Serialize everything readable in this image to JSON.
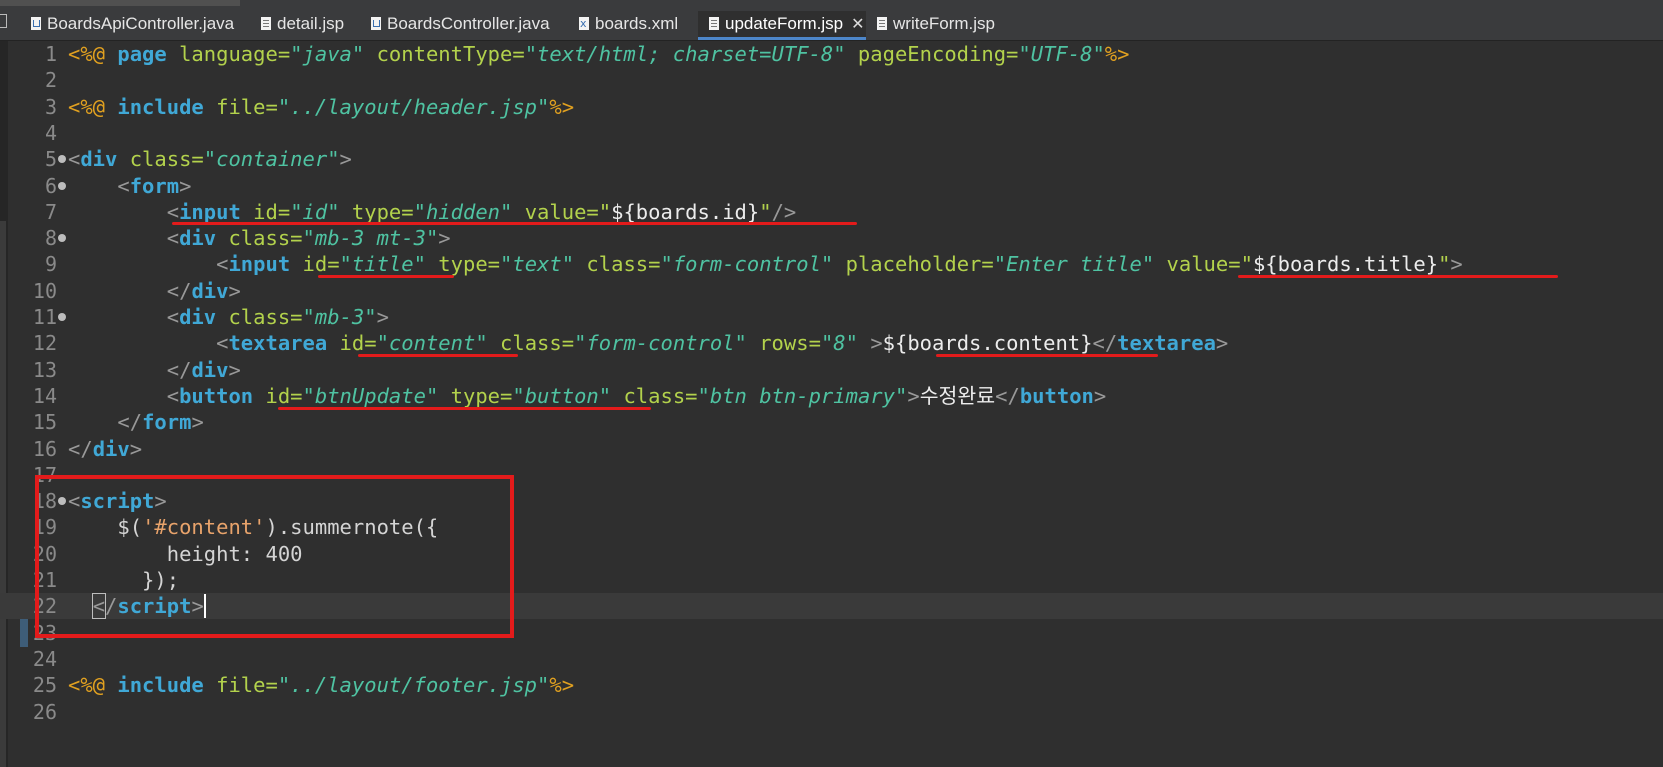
{
  "tabs": [
    {
      "label": "BoardsApiController.java",
      "icon": "java-file-icon",
      "active": false
    },
    {
      "label": "detail.jsp",
      "icon": "jsp-file-icon",
      "active": false
    },
    {
      "label": "BoardsController.java",
      "icon": "java-file-icon",
      "active": false
    },
    {
      "label": "boards.xml",
      "icon": "xml-file-icon",
      "active": false
    },
    {
      "label": "updateForm.jsp",
      "icon": "jsp-file-icon",
      "active": true,
      "close": "✕"
    },
    {
      "label": "writeForm.jsp",
      "icon": "jsp-file-icon",
      "active": false
    }
  ],
  "editor": {
    "active_file": "updateForm.jsp",
    "current_line": 22,
    "lines": [
      {
        "n": "1",
        "fold": false,
        "tokens": [
          [
            "jsp",
            "<%@ "
          ],
          [
            "kw",
            "page"
          ],
          [
            "attr",
            " language="
          ],
          [
            "str",
            "\"java\""
          ],
          [
            "attr",
            " contentType="
          ],
          [
            "str",
            "\"text/html; charset=UTF-8\""
          ],
          [
            "attr",
            " pageEncoding="
          ],
          [
            "str",
            "\"UTF-8\""
          ],
          [
            "jsp",
            "%>"
          ]
        ]
      },
      {
        "n": "2",
        "fold": false,
        "tokens": []
      },
      {
        "n": "3",
        "fold": false,
        "tokens": [
          [
            "jsp",
            "<%@ "
          ],
          [
            "kw",
            "include"
          ],
          [
            "attr",
            " file="
          ],
          [
            "str",
            "\"../layout/header.jsp\""
          ],
          [
            "jsp",
            "%>"
          ]
        ]
      },
      {
        "n": "4",
        "fold": false,
        "tokens": []
      },
      {
        "n": "5",
        "fold": true,
        "tokens": [
          [
            "br",
            "<"
          ],
          [
            "kw",
            "div"
          ],
          [
            "attr",
            " class="
          ],
          [
            "str",
            "\"container\""
          ],
          [
            "br",
            ">"
          ]
        ]
      },
      {
        "n": "6",
        "fold": true,
        "tokens": [
          [
            "txt",
            "    "
          ],
          [
            "br",
            "<"
          ],
          [
            "kw",
            "form"
          ],
          [
            "br",
            ">"
          ]
        ]
      },
      {
        "n": "7",
        "fold": false,
        "tokens": [
          [
            "txt",
            "        "
          ],
          [
            "br",
            "<"
          ],
          [
            "kw",
            "input"
          ],
          [
            "attr",
            " id="
          ],
          [
            "str",
            "\"id\""
          ],
          [
            "attr",
            " type="
          ],
          [
            "str",
            "\"hidden\""
          ],
          [
            "attr",
            " value="
          ],
          [
            "q",
            "\""
          ],
          [
            "txt",
            "${boards.id}"
          ],
          [
            "q",
            "\""
          ],
          [
            "br",
            "/>"
          ]
        ]
      },
      {
        "n": "8",
        "fold": true,
        "tokens": [
          [
            "txt",
            "        "
          ],
          [
            "br",
            "<"
          ],
          [
            "kw",
            "div"
          ],
          [
            "attr",
            " class="
          ],
          [
            "str",
            "\"mb-3 mt-3\""
          ],
          [
            "br",
            ">"
          ]
        ]
      },
      {
        "n": "9",
        "fold": false,
        "tokens": [
          [
            "txt",
            "            "
          ],
          [
            "br",
            "<"
          ],
          [
            "kw",
            "input"
          ],
          [
            "attr",
            " id="
          ],
          [
            "str",
            "\"title\""
          ],
          [
            "attr",
            " type="
          ],
          [
            "str",
            "\"text\""
          ],
          [
            "attr",
            " class="
          ],
          [
            "str",
            "\"form-control\""
          ],
          [
            "attr",
            " placeholder="
          ],
          [
            "str",
            "\"Enter title\""
          ],
          [
            "attr",
            " value="
          ],
          [
            "q",
            "\""
          ],
          [
            "txt",
            "${boards.title}"
          ],
          [
            "q",
            "\""
          ],
          [
            "br",
            ">"
          ]
        ]
      },
      {
        "n": "10",
        "fold": false,
        "tokens": [
          [
            "txt",
            "        "
          ],
          [
            "br",
            "</"
          ],
          [
            "kw",
            "div"
          ],
          [
            "br",
            ">"
          ]
        ]
      },
      {
        "n": "11",
        "fold": true,
        "tokens": [
          [
            "txt",
            "        "
          ],
          [
            "br",
            "<"
          ],
          [
            "kw",
            "div"
          ],
          [
            "attr",
            " class="
          ],
          [
            "str",
            "\"mb-3\""
          ],
          [
            "br",
            ">"
          ]
        ]
      },
      {
        "n": "12",
        "fold": false,
        "tokens": [
          [
            "txt",
            "            "
          ],
          [
            "br",
            "<"
          ],
          [
            "kw",
            "textarea"
          ],
          [
            "attr",
            " id="
          ],
          [
            "str",
            "\"content\""
          ],
          [
            "attr",
            " class="
          ],
          [
            "str",
            "\"form-control\""
          ],
          [
            "attr",
            " rows="
          ],
          [
            "str",
            "\"8\""
          ],
          [
            "txt",
            " "
          ],
          [
            "br",
            ">"
          ],
          [
            "txt",
            "${boards.content}"
          ],
          [
            "br",
            "</"
          ],
          [
            "kw",
            "textarea"
          ],
          [
            "br",
            ">"
          ]
        ]
      },
      {
        "n": "13",
        "fold": false,
        "tokens": [
          [
            "txt",
            "        "
          ],
          [
            "br",
            "</"
          ],
          [
            "kw",
            "div"
          ],
          [
            "br",
            ">"
          ]
        ]
      },
      {
        "n": "14",
        "fold": false,
        "tokens": [
          [
            "txt",
            "        "
          ],
          [
            "br",
            "<"
          ],
          [
            "kw",
            "button"
          ],
          [
            "attr",
            " id="
          ],
          [
            "str",
            "\"btnUpdate\""
          ],
          [
            "attr",
            " type="
          ],
          [
            "str",
            "\"button\""
          ],
          [
            "attr",
            " class="
          ],
          [
            "str",
            "\"btn btn-primary\""
          ],
          [
            "br",
            ">"
          ],
          [
            "txt",
            "수정완료"
          ],
          [
            "br",
            "</"
          ],
          [
            "kw",
            "button"
          ],
          [
            "br",
            ">"
          ]
        ]
      },
      {
        "n": "15",
        "fold": false,
        "tokens": [
          [
            "txt",
            "    "
          ],
          [
            "br",
            "</"
          ],
          [
            "kw",
            "form"
          ],
          [
            "br",
            ">"
          ]
        ]
      },
      {
        "n": "16",
        "fold": false,
        "tokens": [
          [
            "br",
            "</"
          ],
          [
            "kw",
            "div"
          ],
          [
            "br",
            ">"
          ]
        ]
      },
      {
        "n": "17",
        "fold": false,
        "tokens": []
      },
      {
        "n": "18",
        "fold": true,
        "tokens": [
          [
            "br",
            "<"
          ],
          [
            "kw",
            "script"
          ],
          [
            "br",
            ">"
          ]
        ]
      },
      {
        "n": "19",
        "fold": false,
        "tokens": [
          [
            "js",
            "    $("
          ],
          [
            "jsstr",
            "'#content'"
          ],
          [
            "js",
            ").summernote({"
          ]
        ]
      },
      {
        "n": "20",
        "fold": false,
        "tokens": [
          [
            "js",
            "        height: "
          ],
          [
            "num",
            "400"
          ]
        ]
      },
      {
        "n": "21",
        "fold": false,
        "tokens": [
          [
            "js",
            "      });"
          ]
        ]
      },
      {
        "n": "22",
        "fold": false,
        "tokens": [
          [
            "txt",
            "  "
          ],
          [
            "brbox",
            "<"
          ],
          [
            "br",
            "/"
          ],
          [
            "kw",
            "script"
          ],
          [
            "br",
            ">"
          ],
          [
            "caret",
            ""
          ]
        ]
      },
      {
        "n": "23",
        "fold": false,
        "tokens": []
      },
      {
        "n": "24",
        "fold": false,
        "tokens": []
      },
      {
        "n": "25",
        "fold": false,
        "tokens": [
          [
            "jsp",
            "<%@ "
          ],
          [
            "kw",
            "include"
          ],
          [
            "attr",
            " file="
          ],
          [
            "str",
            "\"../layout/footer.jsp\""
          ],
          [
            "jsp",
            "%>"
          ]
        ]
      },
      {
        "n": "26",
        "fold": false,
        "tokens": []
      }
    ]
  },
  "annotations": {
    "color": "#e31b1b",
    "underlines": [
      "line 7 input tag",
      "line 9 id=\"title\"",
      "line 9 value",
      "line 12 id=\"content\"",
      "line 12 ${boards.content}",
      "line 14 id/type"
    ],
    "box": "script block lines 17-23"
  },
  "colors": {
    "background": "#2f2f2f",
    "keyword": "#40a8d6",
    "attribute": "#b3d24c",
    "string": "#4fc3a2",
    "jsp_directive": "#e0a020",
    "js_string": "#e8a36b",
    "active_tab_accent": "#4d86c9"
  }
}
